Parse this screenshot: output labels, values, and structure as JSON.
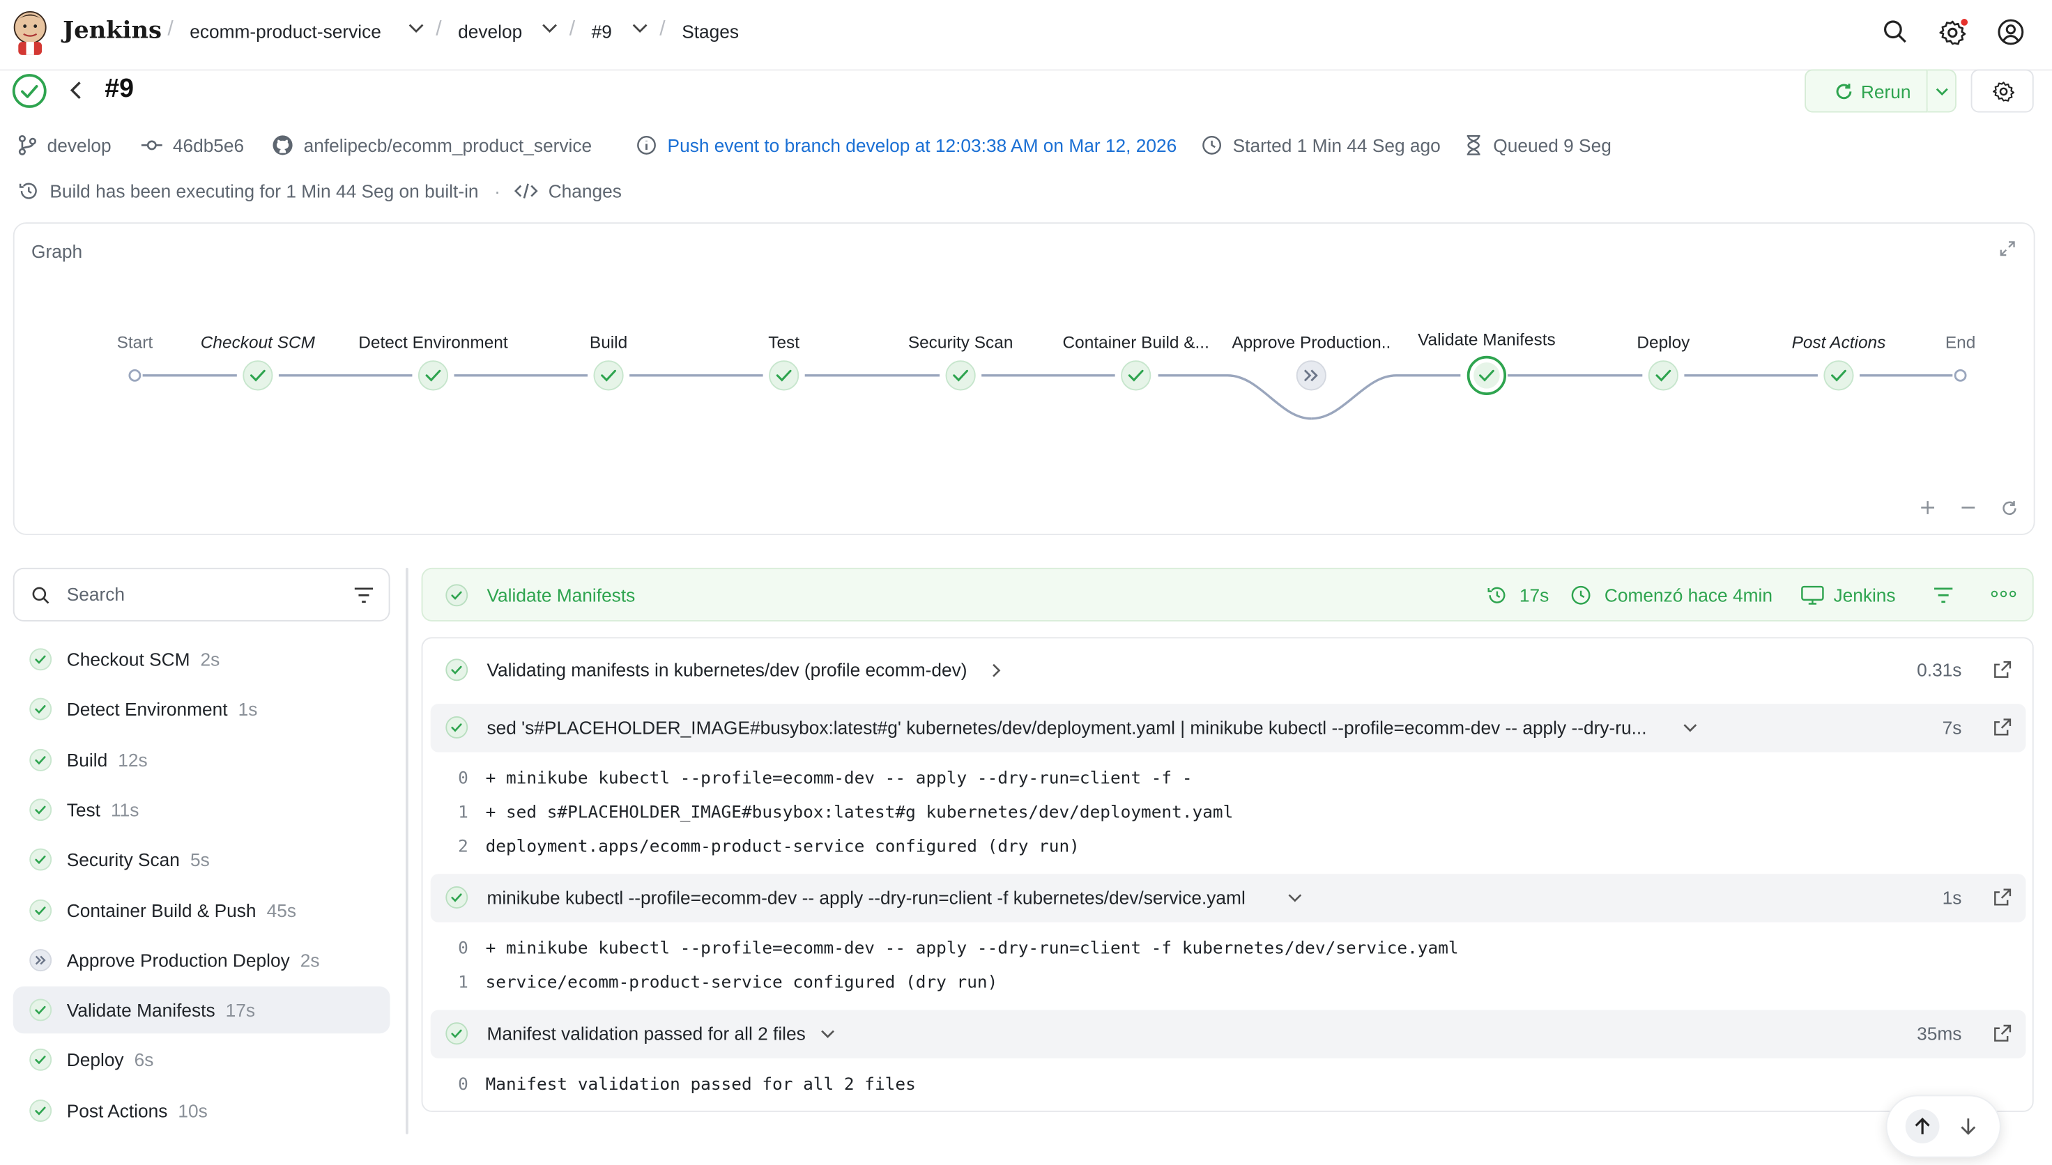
{
  "header": {
    "brand": "Jenkins",
    "crumbs": [
      "ecomm-product-service",
      "develop",
      "#9",
      "Stages"
    ]
  },
  "build": {
    "title": "#9",
    "rerun_label": "Rerun",
    "branch": "develop",
    "commit": "46db5e6",
    "repo": "anfelipecb/ecomm_product_service",
    "trigger": "Push event to branch develop at 12:03:38 AM on Mar 12, 2026",
    "started": "Started 1 Min 44 Seg ago",
    "queued": "Queued 9 Seg",
    "executing": "Build has been executing for 1 Min 44 Seg on built-in",
    "changes": "Changes"
  },
  "graph": {
    "title": "Graph",
    "stages": [
      {
        "label": "Start",
        "kind": "endpoint"
      },
      {
        "label": "Checkout SCM",
        "kind": "success",
        "italic": true
      },
      {
        "label": "Detect Environment",
        "kind": "success"
      },
      {
        "label": "Build",
        "kind": "success"
      },
      {
        "label": "Test",
        "kind": "success"
      },
      {
        "label": "Security Scan",
        "kind": "success"
      },
      {
        "label": "Container Build &...",
        "kind": "success"
      },
      {
        "label": "Approve Production..",
        "kind": "skipped"
      },
      {
        "label": "Validate Manifests",
        "kind": "selected"
      },
      {
        "label": "Deploy",
        "kind": "success"
      },
      {
        "label": "Post Actions",
        "kind": "success",
        "italic": true
      },
      {
        "label": "End",
        "kind": "endpoint"
      }
    ]
  },
  "sidebar": {
    "search_placeholder": "Search",
    "items": [
      {
        "label": "Checkout SCM",
        "duration": "2s",
        "status": "success"
      },
      {
        "label": "Detect Environment",
        "duration": "1s",
        "status": "success"
      },
      {
        "label": "Build",
        "duration": "12s",
        "status": "success"
      },
      {
        "label": "Test",
        "duration": "11s",
        "status": "success"
      },
      {
        "label": "Security Scan",
        "duration": "5s",
        "status": "success"
      },
      {
        "label": "Container Build & Push",
        "duration": "45s",
        "status": "success"
      },
      {
        "label": "Approve Production Deploy",
        "duration": "2s",
        "status": "skipped"
      },
      {
        "label": "Validate Manifests",
        "duration": "17s",
        "status": "success",
        "active": true
      },
      {
        "label": "Deploy",
        "duration": "6s",
        "status": "success"
      },
      {
        "label": "Post Actions",
        "duration": "10s",
        "status": "success"
      }
    ]
  },
  "stage": {
    "name": "Validate Manifests",
    "duration": "17s",
    "started": "Comenzó hace 4min",
    "agent": "Jenkins",
    "steps": [
      {
        "label": "Validating manifests in kubernetes/dev (profile ecomm-dev)",
        "time": "0.31s",
        "log": []
      },
      {
        "label": "sed 's#PLACEHOLDER_IMAGE#busybox:latest#g' kubernetes/dev/deployment.yaml | minikube kubectl --profile=ecomm-dev -- apply --dry-ru...",
        "time": "7s",
        "log": [
          "+ minikube kubectl --profile=ecomm-dev -- apply --dry-run=client -f -",
          "+ sed s#PLACEHOLDER_IMAGE#busybox:latest#g kubernetes/dev/deployment.yaml",
          "deployment.apps/ecomm-product-service configured (dry run)"
        ]
      },
      {
        "label": "minikube kubectl --profile=ecomm-dev -- apply --dry-run=client -f kubernetes/dev/service.yaml",
        "time": "1s",
        "log": [
          "+ minikube kubectl --profile=ecomm-dev -- apply --dry-run=client -f kubernetes/dev/service.yaml",
          "service/ecomm-product-service configured (dry run)"
        ]
      },
      {
        "label": "Manifest validation passed for all 2 files",
        "time": "35ms",
        "log": [
          "Manifest validation passed for all 2 files"
        ]
      }
    ],
    "line_numbers": [
      "0",
      "1",
      "2"
    ]
  },
  "colors": {
    "success": "#2ea44f",
    "link": "#1a6fd4",
    "muted": "#5e6670"
  }
}
